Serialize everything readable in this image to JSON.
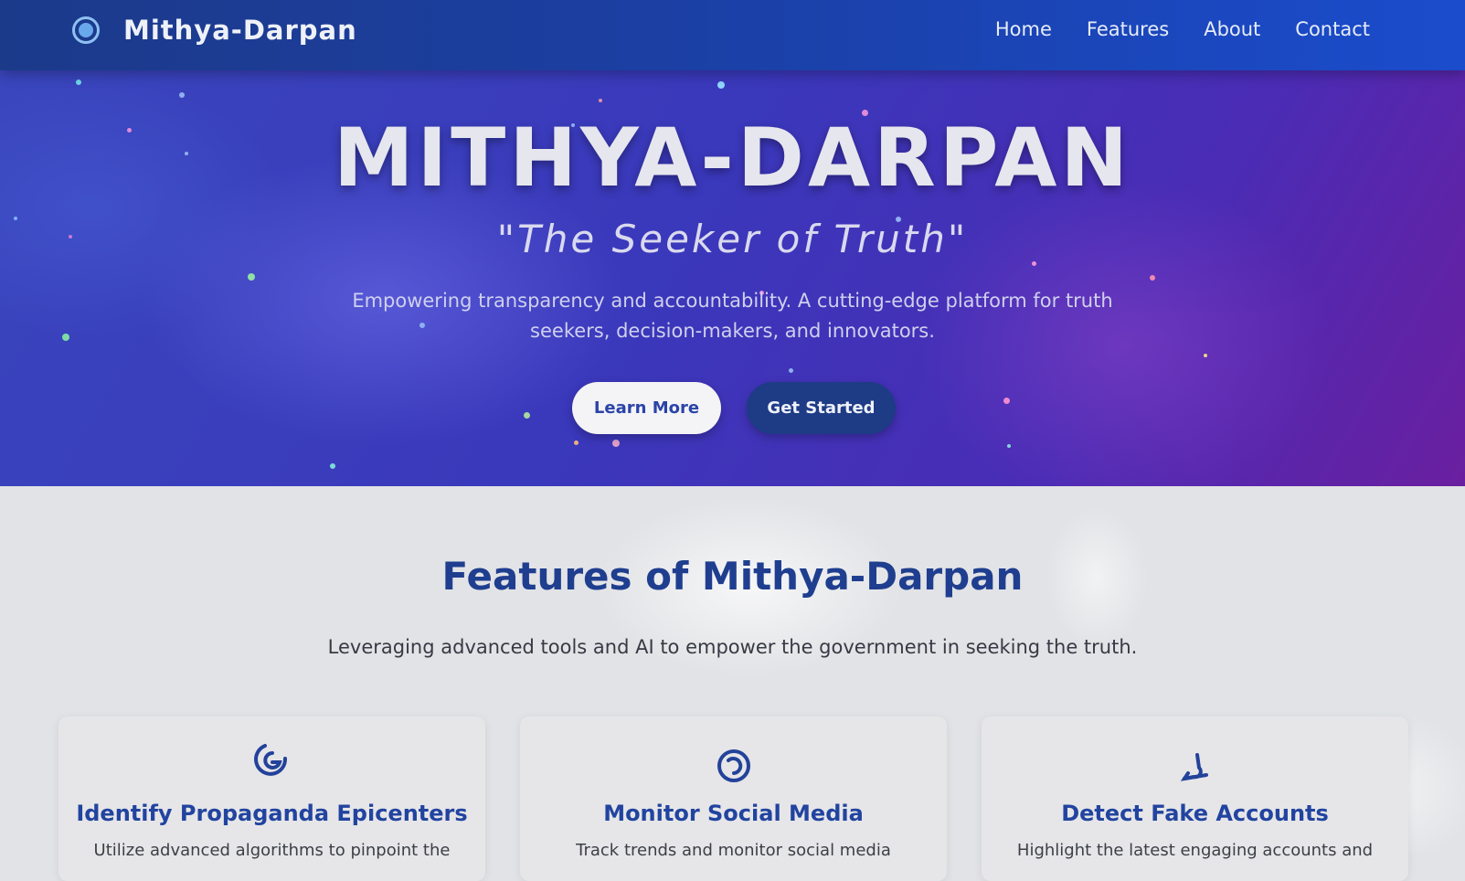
{
  "nav": {
    "brand": "Mithya-Darpan",
    "links": [
      "Home",
      "Features",
      "About",
      "Contact"
    ]
  },
  "hero": {
    "title": "MITHYA-DARPAN",
    "tagline": "\"The Seeker of Truth\"",
    "description": "Empowering transparency and accountability. A cutting-edge platform for truth seekers, decision-makers, and innovators.",
    "learn_more": "Learn More",
    "get_started": "Get Started"
  },
  "features": {
    "title": "Features of Mithya-Darpan",
    "subtitle": "Leveraging advanced tools and AI to empower the government in seeking the truth.",
    "cards": [
      {
        "icon": "spiral-icon",
        "title": "Identify Propaganda Epicenters",
        "text": "Utilize advanced algorithms to pinpoint the"
      },
      {
        "icon": "circle-refresh-icon",
        "title": "Monitor Social Media",
        "text": "Track trends and monitor social media"
      },
      {
        "icon": "hook-icon",
        "title": "Detect Fake Accounts",
        "text": "Highlight the latest engaging accounts and"
      }
    ]
  },
  "colors": {
    "nav_bg": "#1b3fa3",
    "hero_bg": "#3a38bb",
    "accent_blue": "#2244a0",
    "page_bg": "#e2e3e6"
  }
}
